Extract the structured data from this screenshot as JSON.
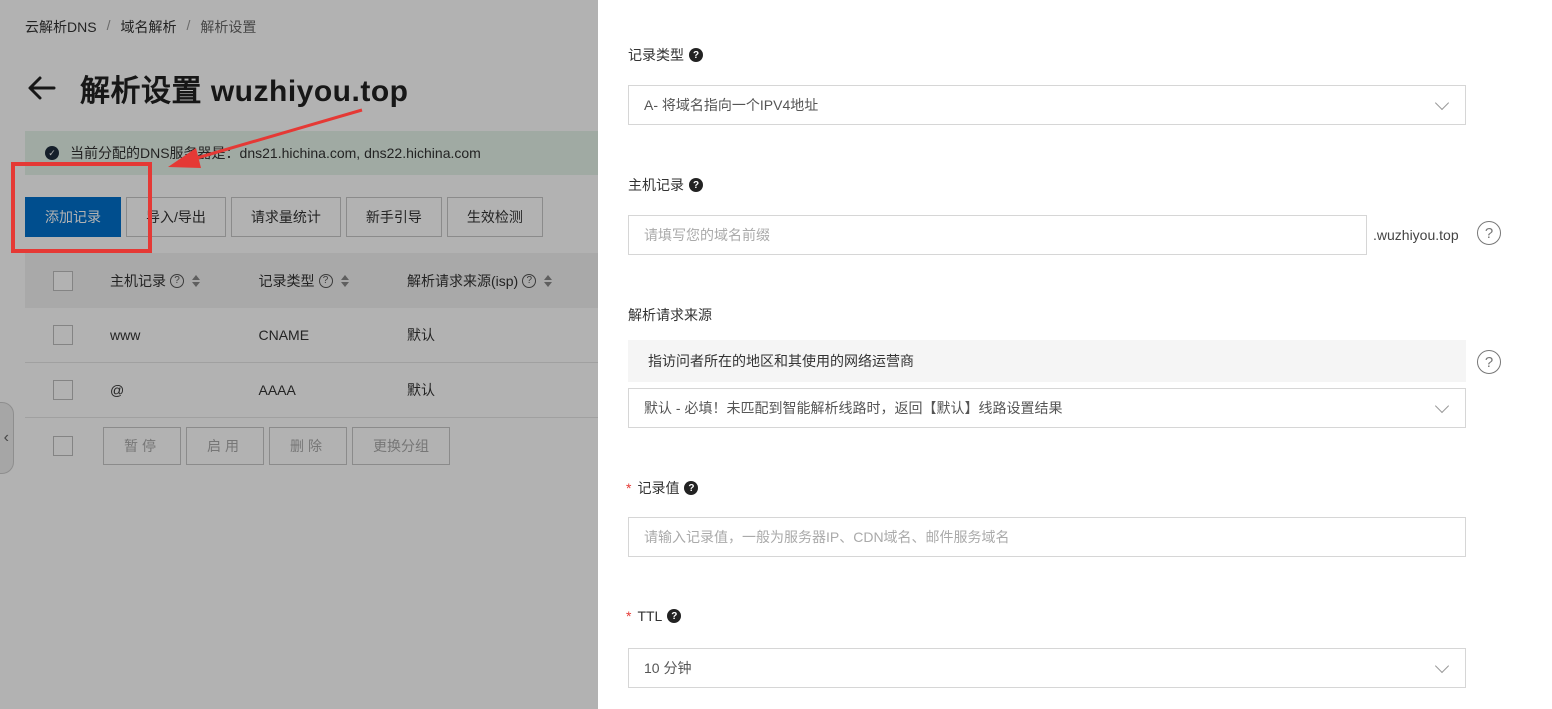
{
  "breadcrumb": {
    "items": [
      "云解析DNS",
      "域名解析",
      "解析设置"
    ]
  },
  "page": {
    "title": "解析设置 wuzhiyou.top"
  },
  "dns_banner": {
    "text": "当前分配的DNS服务器是：dns21.hichina.com, dns22.hichina.com"
  },
  "toolbar": {
    "add_record": "添加记录",
    "import_export": "导入/导出",
    "request_stats": "请求量统计",
    "beginner_guide": "新手引导",
    "effect_check": "生效检测"
  },
  "table": {
    "columns": [
      "主机记录",
      "记录类型",
      "解析请求来源(isp)"
    ],
    "rows": [
      [
        "www",
        "CNAME",
        "默认"
      ],
      [
        "@",
        "AAAA",
        "默认"
      ]
    ]
  },
  "bulk_actions": {
    "pause": "暂停",
    "enable": "启用",
    "delete": "删除",
    "change_group": "更换分组"
  },
  "form": {
    "record_type": {
      "label": "记录类型",
      "value": "A- 将域名指向一个IPV4地址"
    },
    "host_record": {
      "label": "主机记录",
      "placeholder": "请填写您的域名前缀",
      "suffix": ".wuzhiyou.top"
    },
    "request_source": {
      "label": "解析请求来源",
      "hint": "指访问者所在的地区和其使用的网络运营商",
      "value": "默认 - 必填！未匹配到智能解析线路时，返回【默认】线路设置结果"
    },
    "record_value": {
      "required_mark": "*",
      "label": "记录值",
      "placeholder": "请输入记录值，一般为服务器IP、CDN域名、邮件服务域名"
    },
    "ttl": {
      "required_mark": "*",
      "label": "TTL",
      "value": "10 分钟"
    }
  },
  "icons": {
    "back": "arrow-left-icon",
    "check": "check-circle-icon",
    "help": "question-circle-icon",
    "sort": "sort-icon",
    "chevron": "chevron-down-icon"
  },
  "colors": {
    "primary": "#0070cc",
    "banner_bg": "#e6f4ea",
    "annotation_red": "#e53935"
  }
}
